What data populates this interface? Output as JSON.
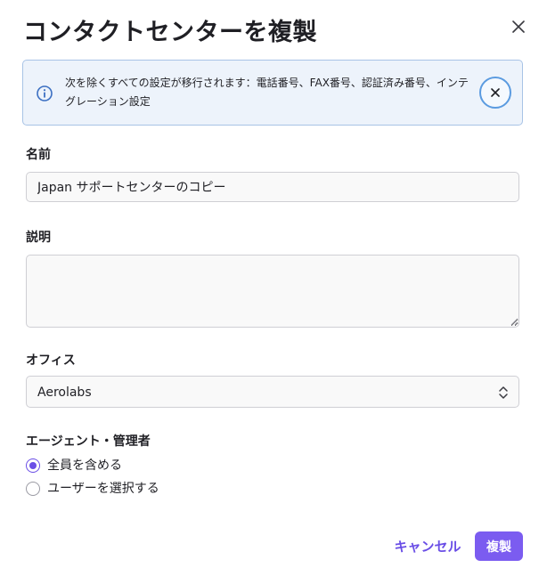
{
  "dialog": {
    "title": "コンタクトセンターを複製"
  },
  "banner": {
    "message": "次を除くすべての設定が移行されます：電話番号、FAX番号、認証済み番号、インテグレーション設定"
  },
  "form": {
    "name_label": "名前",
    "name_value": "Japan サポートセンターのコピー",
    "description_label": "説明",
    "description_value": "",
    "office_label": "オフィス",
    "office_value": "Aerolabs",
    "agents_label": "エージェント・管理者",
    "agents_options": [
      {
        "label": "全員を含める",
        "checked": true
      },
      {
        "label": "ユーザーを選択する",
        "checked": false
      }
    ]
  },
  "footer": {
    "cancel_label": "キャンセル",
    "submit_label": "複製"
  },
  "colors": {
    "accent": "#7b5cf0",
    "accent_text": "#6a4ee6",
    "banner_bg": "#edf3fb",
    "banner_border": "#a8c3e6",
    "info_icon": "#3b6fc2"
  },
  "icons": {
    "close": "close-icon",
    "info": "info-icon",
    "banner_close": "close-icon",
    "select": "chevron-updown-icon"
  }
}
